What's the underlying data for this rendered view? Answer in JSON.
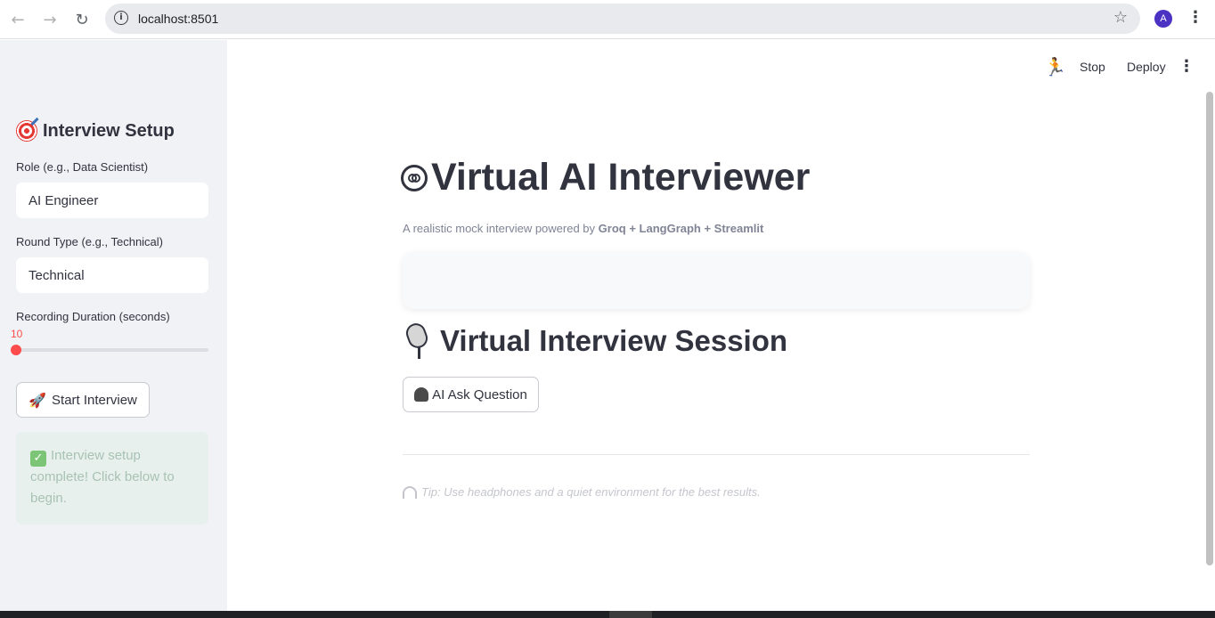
{
  "browser": {
    "url": "localhost:8501",
    "profile_initial": "A"
  },
  "sidebar": {
    "title": "Interview Setup",
    "role_label": "Role (e.g., Data Scientist)",
    "role_value": "AI Engineer",
    "round_label": "Round Type (e.g., Technical)",
    "round_value": "Technical",
    "duration_label": "Recording Duration (seconds)",
    "duration_value": "10",
    "duration_fraction": 0.0,
    "start_button": "Start Interview",
    "success_message": "Interview setup complete! Click below to begin."
  },
  "toolbar": {
    "stop_label": "Stop",
    "deploy_label": "Deploy"
  },
  "main": {
    "title": "Virtual AI Interviewer",
    "subtitle_prefix": "A realistic mock interview powered by ",
    "subtitle_bold": "Groq + LangGraph + Streamlit",
    "section_title": "Virtual Interview Session",
    "ask_button": "AI Ask Question",
    "tip": "Tip: Use headphones and a quiet environment for the best results."
  },
  "colors": {
    "accent": "#ff4b4b",
    "sidebar_bg": "#f0f2f6",
    "text": "#31333f",
    "success_bg": "#e8f0ee"
  },
  "icons": {
    "sidebar_title": "target-icon",
    "start_button": "rocket-icon",
    "success": "check-icon",
    "title": "robot-face-icon",
    "section": "microphone-icon",
    "ask_button": "person-icon",
    "tip": "headphones-icon"
  }
}
